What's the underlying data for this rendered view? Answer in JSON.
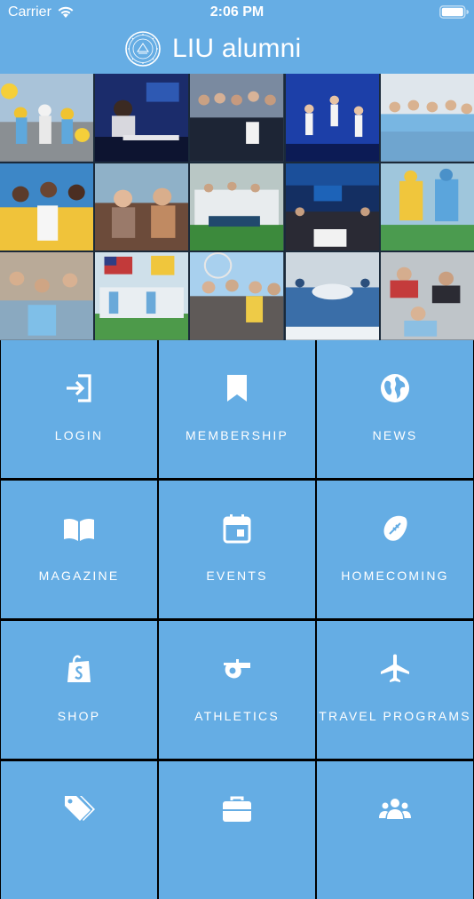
{
  "status_bar": {
    "carrier": "Carrier",
    "time": "2:06 PM"
  },
  "header": {
    "title": "LIU alumni",
    "logo_icon": "liu-seal-icon"
  },
  "collage": {
    "photos": [
      "cheerleaders-photo",
      "music-studio-photo",
      "group-photo",
      "dancers-photo",
      "team-photo",
      "students-photo",
      "students-talking-photo",
      "team-celebration-photo",
      "nasdaq-photo",
      "football-photo",
      "students-group-photo",
      "lacrosse-flag-photo",
      "fair-group-photo",
      "hockey-team-photo",
      "students-lying-photo"
    ]
  },
  "menu": {
    "items": [
      {
        "label": "LOGIN",
        "icon": "login-icon"
      },
      {
        "label": "MEMBERSHIP",
        "icon": "bookmark-icon"
      },
      {
        "label": "NEWS",
        "icon": "globe-icon"
      },
      {
        "label": "MAGAZINE",
        "icon": "book-icon"
      },
      {
        "label": "EVENTS",
        "icon": "calendar-icon"
      },
      {
        "label": "HOMECOMING",
        "icon": "football-icon"
      },
      {
        "label": "SHOP",
        "icon": "shopping-bag-icon"
      },
      {
        "label": "ATHLETICS",
        "icon": "whistle-icon"
      },
      {
        "label": "TRAVEL PROGRAMS",
        "icon": "airplane-icon"
      },
      {
        "label": "",
        "icon": "tags-icon"
      },
      {
        "label": "",
        "icon": "briefcase-icon"
      },
      {
        "label": "",
        "icon": "people-icon"
      }
    ]
  },
  "colors": {
    "accent": "#66ade4",
    "tile": "#65ade4",
    "text": "#ffffff"
  }
}
